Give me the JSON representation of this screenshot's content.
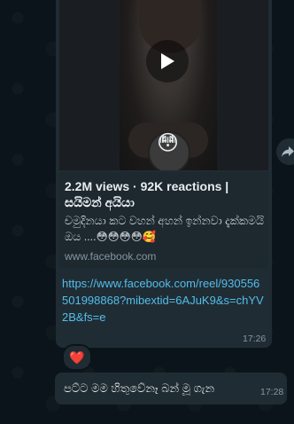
{
  "message1": {
    "video": {
      "sticker_label": "Edits",
      "play_icon": "play-icon"
    },
    "preview": {
      "title": "2.2M views · 92K reactions |",
      "subtitle": "සයිමන් අයියා",
      "description": "චමුදිනයා කට වහන් අහන් ඉන්නවා දැක්කමයි ඔය ....😳😳😳😳🥰",
      "domain": "www.facebook.com"
    },
    "url": "https://www.facebook.com/reel/930556501998868?mibextid=6AJuK9&s=chYV2B&fs=e",
    "time": "17:26",
    "reaction": "❤️"
  },
  "forward_icon": "forward-icon",
  "message2": {
    "text": "පට්ට මම හිතුවේනෑ බන් මූ ගැන",
    "time": "17:28"
  },
  "colors": {
    "background": "#0b141a",
    "bubble": "#202c33",
    "link": "#53bdeb",
    "meta": "#8696a0"
  }
}
